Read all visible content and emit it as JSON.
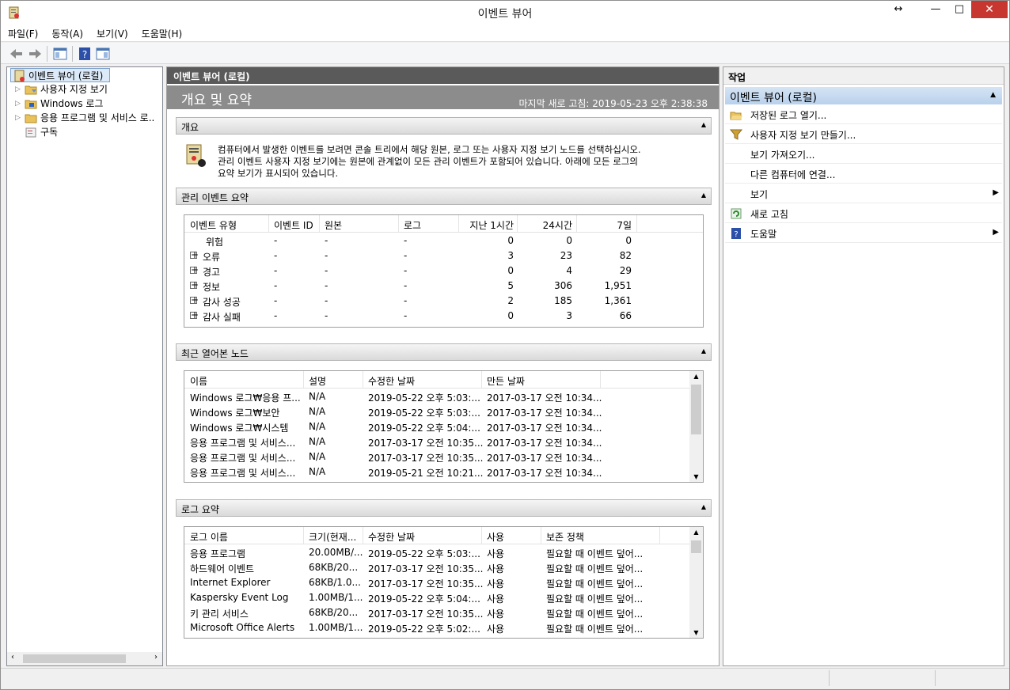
{
  "window": {
    "title": "이벤트 뷰어",
    "restore": "↔",
    "minimize": "—",
    "maximize": "□",
    "close": "✕"
  },
  "menu": [
    "파일(F)",
    "동작(A)",
    "보기(V)",
    "도움말(H)"
  ],
  "tree": {
    "root": "이벤트 뷰어 (로컬)",
    "items": [
      "사용자 지정 보기",
      "Windows 로그",
      "응용 프로그램 및 서비스 로..",
      "구독"
    ]
  },
  "center": {
    "header": "이벤트 뷰어 (로컬)",
    "banner_title": "개요 및 요약",
    "last_refresh": "마지막 새로 고침: 2019-05-23 오후 2:38:38",
    "overview": {
      "title": "개요",
      "text": [
        "컴퓨터에서 발생한 이벤트를 보려면 콘솔 트리에서 해당 원본, 로그 또는 사용자 지정 보기 노드를 선택하십시오.",
        "관리 이벤트 사용자 지정 보기에는 원본에 관계없이 모든 관리 이벤트가 포함되어 있습니다. 아래에 모든 로그의",
        "요약 보기가 표시되어 있습니다."
      ]
    },
    "summary": {
      "title": "관리 이벤트 요약",
      "columns": [
        "이벤트 유형",
        "이벤트 ID",
        "원본",
        "로그",
        "지난 1시간",
        "24시간",
        "7일"
      ],
      "rows": [
        [
          "위험",
          "-",
          "-",
          "-",
          "0",
          "0",
          "0"
        ],
        [
          "오류",
          "-",
          "-",
          "-",
          "3",
          "23",
          "82"
        ],
        [
          "경고",
          "-",
          "-",
          "-",
          "0",
          "4",
          "29"
        ],
        [
          "정보",
          "-",
          "-",
          "-",
          "5",
          "306",
          "1,951"
        ],
        [
          "감사 성공",
          "-",
          "-",
          "-",
          "2",
          "185",
          "1,361"
        ],
        [
          "감사 실패",
          "-",
          "-",
          "-",
          "0",
          "3",
          "66"
        ]
      ]
    },
    "recent": {
      "title": "최근 열어본 노드",
      "columns": [
        "이름",
        "설명",
        "수정한 날짜",
        "만든 날짜"
      ],
      "rows": [
        [
          "Windows 로그₩응용 프...",
          "N/A",
          "2019-05-22 오후 5:03:...",
          "2017-03-17 오전 10:34..."
        ],
        [
          "Windows 로그₩보안",
          "N/A",
          "2019-05-22 오후 5:03:...",
          "2017-03-17 오전 10:34..."
        ],
        [
          "Windows 로그₩시스템",
          "N/A",
          "2019-05-22 오후 5:04:...",
          "2017-03-17 오전 10:34..."
        ],
        [
          "응용 프로그램 및 서비스...",
          "N/A",
          "2017-03-17 오전 10:35...",
          "2017-03-17 오전 10:34..."
        ],
        [
          "응용 프로그램 및 서비스...",
          "N/A",
          "2017-03-17 오전 10:35...",
          "2017-03-17 오전 10:34..."
        ],
        [
          "응용 프로그램 및 서비스...",
          "N/A",
          "2019-05-21 오전 10:21...",
          "2017-03-17 오전 10:34..."
        ]
      ]
    },
    "logs": {
      "title": "로그 요약",
      "columns": [
        "로그 이름",
        "크기(현재...",
        "수정한 날짜",
        "사용",
        "보존 정책"
      ],
      "rows": [
        [
          "응용 프로그램",
          "20.00MB/...",
          "2019-05-22 오후 5:03:...",
          "사용",
          "필요할 때 이벤트 덮어..."
        ],
        [
          "하드웨어 이벤트",
          "68KB/20...",
          "2017-03-17 오전 10:35...",
          "사용",
          "필요할 때 이벤트 덮어..."
        ],
        [
          "Internet Explorer",
          "68KB/1.0...",
          "2017-03-17 오전 10:35...",
          "사용",
          "필요할 때 이벤트 덮어..."
        ],
        [
          "Kaspersky Event Log",
          "1.00MB/1...",
          "2019-05-22 오후 5:04:...",
          "사용",
          "필요할 때 이벤트 덮어..."
        ],
        [
          "키 관리 서비스",
          "68KB/20...",
          "2017-03-17 오전 10:35...",
          "사용",
          "필요할 때 이벤트 덮어..."
        ],
        [
          "Microsoft Office Alerts",
          "1.00MB/1...",
          "2019-05-22 오후 5:02:...",
          "사용",
          "필요할 때 이벤트 덮어..."
        ]
      ]
    }
  },
  "actions": {
    "title": "작업",
    "group": "이벤트 뷰어 (로컬)",
    "items": [
      "저장된 로그 열기...",
      "사용자 지정 보기 만들기...",
      "보기 가져오기...",
      "다른 컴퓨터에 연결...",
      "보기",
      "새로 고침",
      "도움말"
    ]
  },
  "colors": {
    "accent": "#b9d1ec",
    "banner": "#8c8c8c",
    "header": "#5a5a5a",
    "close": "#c7372f"
  }
}
